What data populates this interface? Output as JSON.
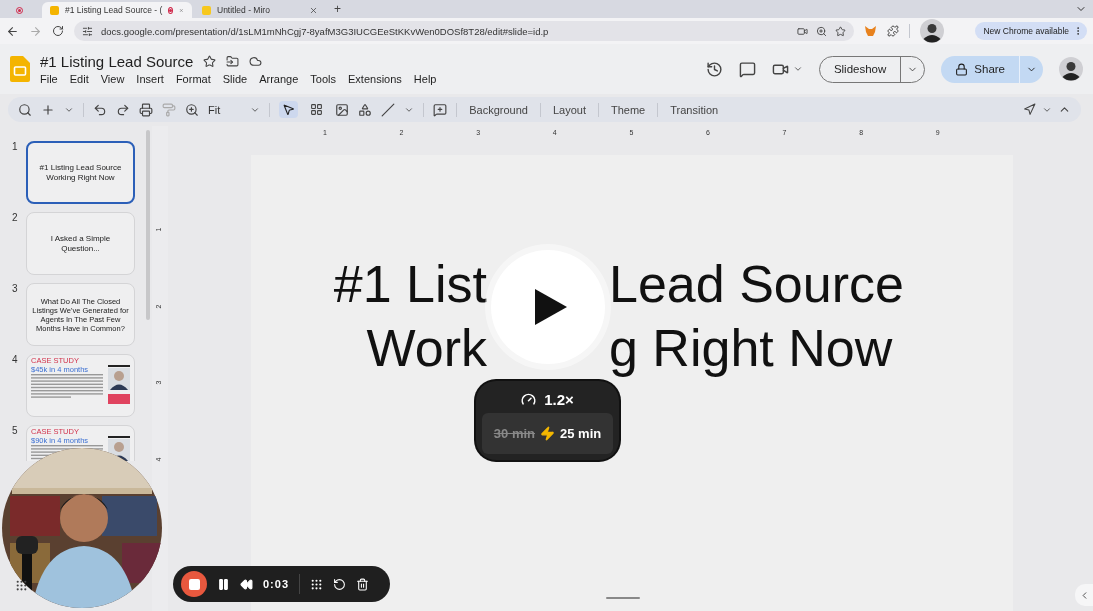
{
  "browser": {
    "tabs": [
      {
        "kind": "icon",
        "selected": false
      },
      {
        "kind": "page",
        "title": "#1 Listing Lead Source - (",
        "selected": true,
        "recording": true
      },
      {
        "kind": "page",
        "title": "Untitled - Miro",
        "selected": false,
        "recording": false
      }
    ],
    "new_tab": "+",
    "url": "docs.google.com/presentation/d/1sLM1mNhCgj7-8yafM3G3IUCGEeStKKvWen0DOSf8T28/edit#slide=id.p",
    "update_chip": "New Chrome available"
  },
  "doc": {
    "title": "#1 Listing Lead Source",
    "menu": [
      "File",
      "Edit",
      "View",
      "Insert",
      "Format",
      "Slide",
      "Arrange",
      "Tools",
      "Extensions",
      "Help"
    ],
    "slideshow": "Slideshow",
    "share": "Share"
  },
  "toolbar": {
    "zoom": "Fit",
    "buttons": [
      "Background",
      "Layout",
      "Theme",
      "Transition"
    ]
  },
  "filmstrip": [
    {
      "number": "1",
      "selected": true,
      "kind": "title",
      "lines": [
        "#1 Listing Lead Source",
        "Working Right Now"
      ]
    },
    {
      "number": "2",
      "selected": false,
      "kind": "title",
      "lines": [
        "I Asked a Simple Question..."
      ]
    },
    {
      "number": "3",
      "selected": false,
      "kind": "title",
      "lines": [
        "What Do All The Closed Listings We've Generated for Agents In The Past Few Months Have in Common?"
      ]
    },
    {
      "number": "4",
      "selected": false,
      "kind": "case",
      "label": "CASE STUDY",
      "heading": "$45k in 4 months"
    },
    {
      "number": "5",
      "selected": false,
      "kind": "case",
      "label": "CASE STUDY",
      "heading": "$90k in 4 months"
    }
  ],
  "ruler": {
    "horizontal": [
      "1",
      "2",
      "3",
      "4",
      "5",
      "6",
      "7",
      "8",
      "9"
    ],
    "vertical": [
      "1",
      "2",
      "3",
      "4"
    ]
  },
  "slide": {
    "title_lines": [
      {
        "left": "#1 List",
        "right": "Lead Source"
      },
      {
        "left": "Work",
        "right": "g Right Now"
      }
    ]
  },
  "speed_popup": {
    "speed": "1.2×",
    "old_time": "30 min",
    "new_time": "25 min"
  },
  "recorder": {
    "time": "0:03"
  }
}
